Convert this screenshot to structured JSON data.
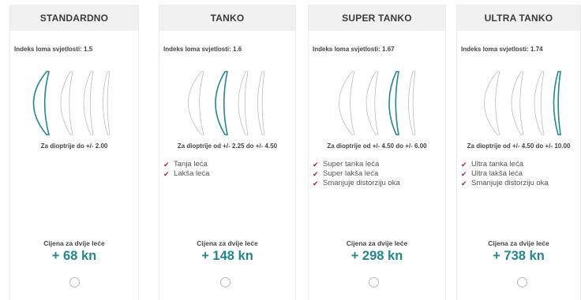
{
  "accent_color": "#21888f",
  "check_color": "#b51f4a",
  "cards": [
    {
      "title": "STANDARDNO",
      "index_label": "Indeks loma svjetlosti: 1.5",
      "diopter": "Za dioptrije do +/- 2.00",
      "features": [],
      "price_label": "Cijena za dvije leće",
      "price": "+ 68 kn",
      "selected": false
    },
    {
      "title": "TANKO",
      "index_label": "Indeks loma svjetlosti: 1.6",
      "diopter": "Za dioptrije od +/- 2.25 do +/- 4.50",
      "features": [
        "Tanja leća",
        "Lakša leća"
      ],
      "price_label": "Cijena za dvije leće",
      "price": "+ 148 kn",
      "selected": false
    },
    {
      "title": "SUPER TANKO",
      "index_label": "Indeks loma svjetlosti: 1.67",
      "diopter": "Za dioptrije od +/- 4.50 do +/- 6.00",
      "features": [
        "Super tanka leća",
        "Super lakša leća",
        "Smanjuje distorziju oka"
      ],
      "price_label": "Cijena za dvije leće",
      "price": "+ 298 kn",
      "selected": false
    },
    {
      "title": "ULTRA TANKO",
      "index_label": "Indeks loma svjetlosti: 1.74",
      "diopter": "Za dioptrije od +/- 4.50 do +/- 10.00",
      "features": [
        "Ultra tanka leća",
        "Ultra lakša leća",
        "Smanjuje distorziju oka"
      ],
      "price_label": "Cijena za dvije leće",
      "price": "+ 738 kn",
      "selected": false
    }
  ]
}
